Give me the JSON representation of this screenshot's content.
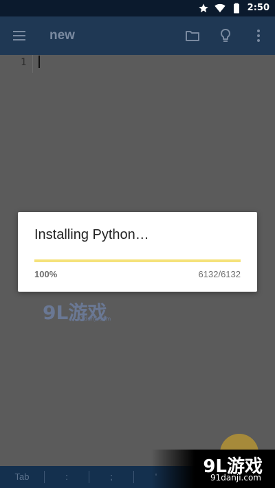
{
  "status_bar": {
    "time": "2:50",
    "icons": [
      "star-icon",
      "wifi-icon",
      "battery-icon"
    ]
  },
  "app_bar": {
    "title": "new",
    "actions": [
      "menu-icon",
      "folder-icon",
      "lightbulb-icon",
      "more-vert-icon"
    ]
  },
  "editor": {
    "line_numbers": [
      "1"
    ],
    "content": ""
  },
  "dialog": {
    "title": "Installing Python…",
    "progress_percent": "100%",
    "progress_fraction": 1.0,
    "progress_count": "6132/6132"
  },
  "symbol_bar": {
    "keys": [
      "Tab",
      ":",
      ";",
      "'"
    ]
  },
  "watermark": {
    "logo_mid": "9L游戏",
    "url_mid": "91danji.com",
    "logo_corner": "9L游戏",
    "url_corner": "91danji.com"
  },
  "colors": {
    "app_bar": "#1f3854",
    "status_bar": "#0b1a2d",
    "dim_overlay": "#5b5b5b",
    "progress": "#f5e27a",
    "symbol_bar": "#14304e"
  }
}
